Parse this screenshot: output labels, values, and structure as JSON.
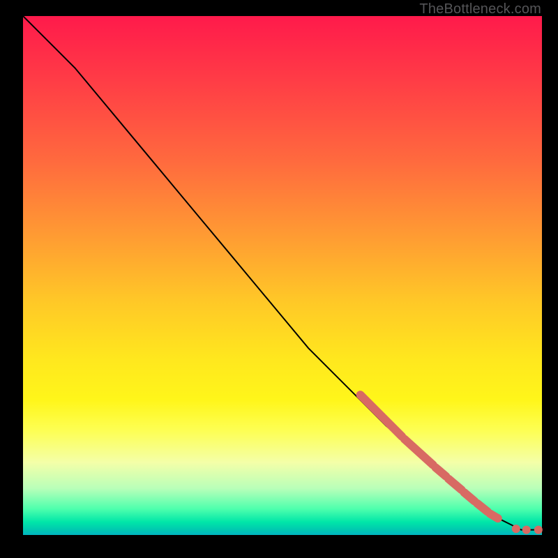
{
  "watermark": "TheBottleneck.com",
  "chart_data": {
    "type": "line",
    "title": "",
    "xlabel": "",
    "ylabel": "",
    "xlim": [
      0,
      100
    ],
    "ylim": [
      0,
      100
    ],
    "grid": false,
    "legend": false,
    "series": [
      {
        "name": "curve",
        "style": "line",
        "color": "#000000",
        "x": [
          0,
          3,
          6,
          10,
          15,
          20,
          25,
          30,
          35,
          40,
          45,
          50,
          55,
          60,
          65,
          70,
          75,
          80,
          85,
          88,
          90,
          92,
          94,
          96,
          98,
          100
        ],
        "y": [
          100,
          97,
          94,
          90,
          84,
          78,
          72,
          66,
          60,
          54,
          48,
          42,
          36,
          31,
          26,
          21,
          17,
          13,
          9,
          6,
          4,
          3,
          2,
          1,
          1,
          1
        ]
      },
      {
        "name": "highlight-segments",
        "style": "thick-line",
        "color": "#d86a63",
        "segments": [
          {
            "x": [
              65,
              73
            ],
            "y": [
              27,
              19
            ]
          },
          {
            "x": [
              73.5,
              79
            ],
            "y": [
              18.5,
              13.5
            ]
          },
          {
            "x": [
              79.5,
              81.5
            ],
            "y": [
              13,
              11.3
            ]
          },
          {
            "x": [
              82,
              84.5
            ],
            "y": [
              10.8,
              8.7
            ]
          },
          {
            "x": [
              85,
              87
            ],
            "y": [
              8.2,
              6.5
            ]
          },
          {
            "x": [
              87.5,
              89.5
            ],
            "y": [
              6.1,
              4.5
            ]
          },
          {
            "x": [
              90,
              91.5
            ],
            "y": [
              4.1,
              3.2
            ]
          }
        ]
      },
      {
        "name": "highlight-dots",
        "style": "dot",
        "color": "#d86a63",
        "points": [
          {
            "x": 95,
            "y": 1.2
          },
          {
            "x": 97,
            "y": 1.0
          },
          {
            "x": 99.3,
            "y": 1.0
          }
        ]
      }
    ]
  }
}
